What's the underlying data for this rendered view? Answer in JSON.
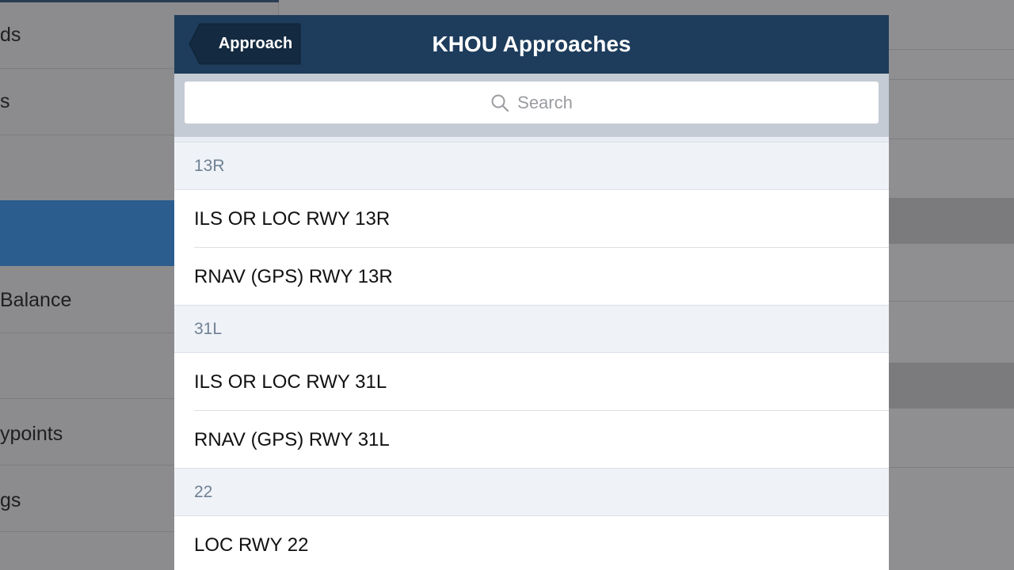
{
  "background": {
    "sidebar_items": [
      "ds",
      "s",
      "",
      "",
      "Balance",
      "",
      "ypoints",
      "gs"
    ]
  },
  "nav": {
    "back_label": "Approach",
    "title": "KHOU Approaches"
  },
  "search": {
    "placeholder": "Search"
  },
  "sections": [
    {
      "header": "13R",
      "items": [
        "ILS OR LOC RWY 13R",
        "RNAV (GPS) RWY 13R"
      ]
    },
    {
      "header": "31L",
      "items": [
        "ILS OR LOC RWY 31L",
        "RNAV (GPS) RWY 31L"
      ]
    },
    {
      "header": "22",
      "items": [
        "LOC RWY 22"
      ]
    }
  ],
  "colors": {
    "nav_bar": "#1e3d5c",
    "selected_sidebar": "#2b5d8e",
    "section_header_bg": "#eff2f7",
    "section_header_text": "#6f8193"
  }
}
